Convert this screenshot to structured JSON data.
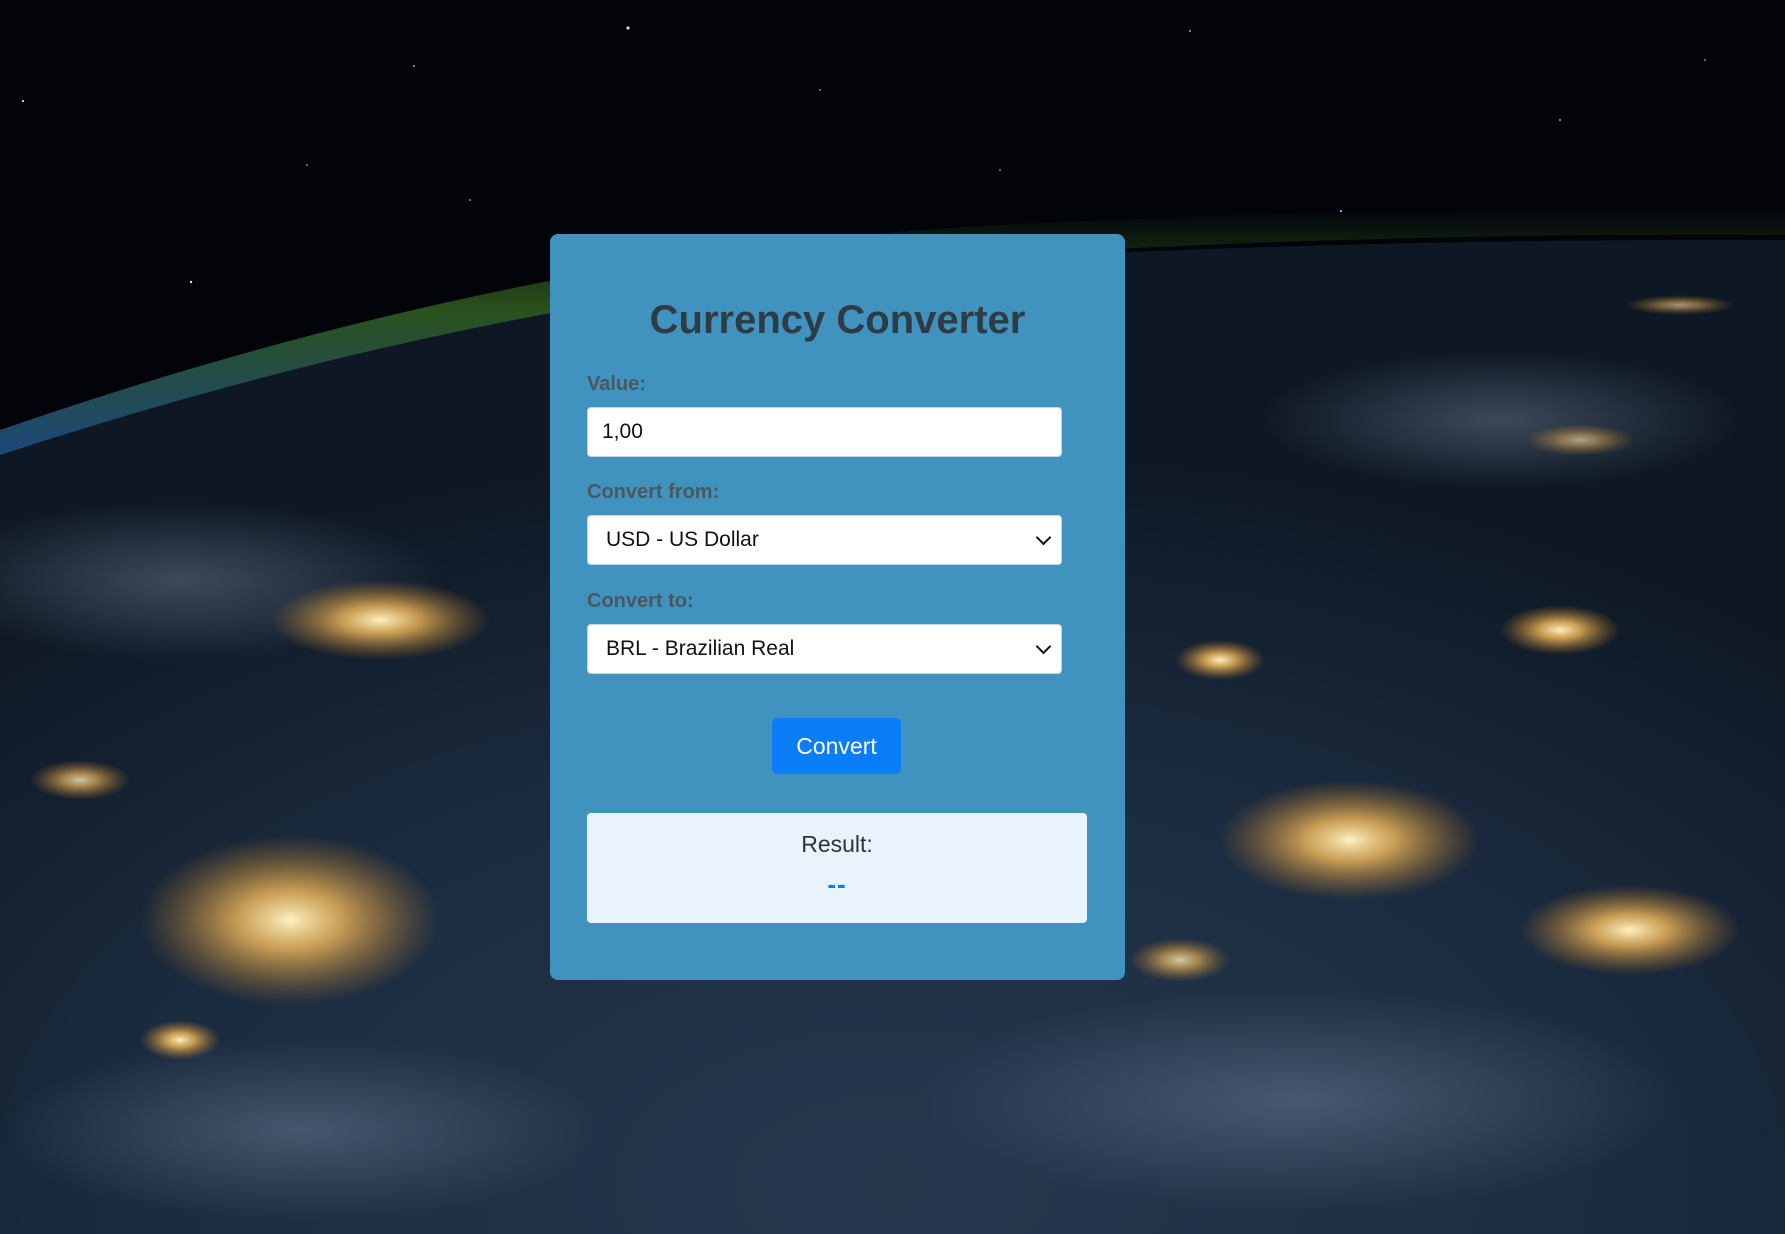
{
  "colors": {
    "card_background": "#4093be",
    "accent": "#0a7df8",
    "result_background": "#e8f3fd",
    "title_color": "#2f3b45",
    "label_color": "#4a5761"
  },
  "converter": {
    "title": "Currency Converter",
    "value_label": "Value:",
    "value": "1,00",
    "from_label": "Convert from:",
    "from_selected": "USD - US Dollar",
    "to_label": "Convert to:",
    "to_selected": "BRL - Brazilian Real",
    "convert_button": "Convert",
    "result_label": "Result:",
    "result_value": "--"
  },
  "icons": {
    "from_dropdown": "chevron-down-icon",
    "to_dropdown": "chevron-down-icon"
  }
}
